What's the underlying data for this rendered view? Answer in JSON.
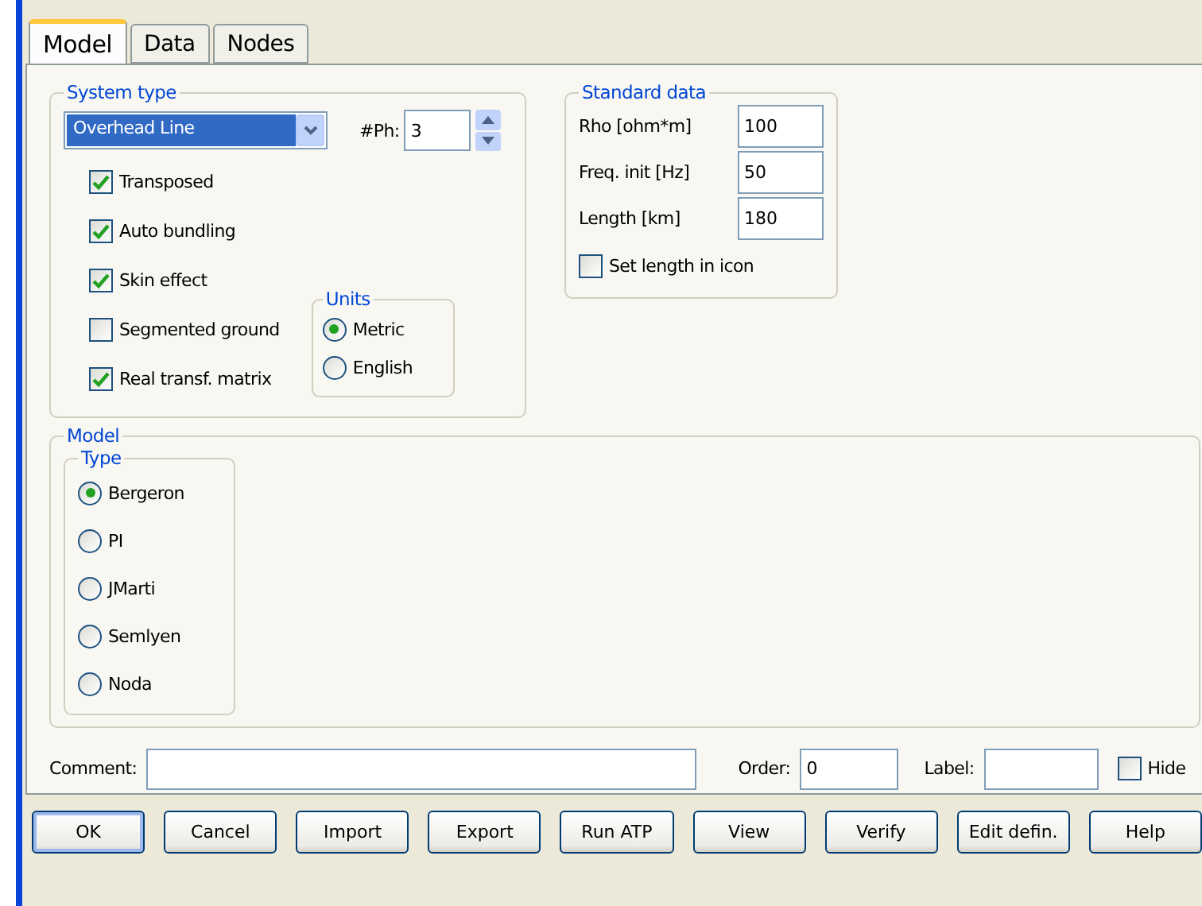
{
  "tabs": [
    {
      "label": "Model",
      "selected": true
    },
    {
      "label": "Data",
      "selected": false
    },
    {
      "label": "Nodes",
      "selected": false
    }
  ],
  "system_type": {
    "title": "System type",
    "dropdown": {
      "value": "Overhead Line"
    },
    "phases": {
      "label": "#Ph:",
      "value": "3"
    },
    "options": [
      {
        "label": "Transposed",
        "checked": true
      },
      {
        "label": "Auto bundling",
        "checked": true
      },
      {
        "label": "Skin effect",
        "checked": true
      },
      {
        "label": "Segmented ground",
        "checked": false
      },
      {
        "label": "Real transf. matrix",
        "checked": true
      }
    ],
    "units": {
      "title": "Units",
      "options": [
        {
          "label": "Metric",
          "selected": true
        },
        {
          "label": "English",
          "selected": false
        }
      ]
    }
  },
  "standard_data": {
    "title": "Standard data",
    "fields": [
      {
        "label": "Rho [ohm*m]",
        "value": "100"
      },
      {
        "label": "Freq. init [Hz]",
        "value": "50"
      },
      {
        "label": "Length [km]",
        "value": "180"
      }
    ],
    "set_length": {
      "label": "Set length in icon",
      "checked": false
    }
  },
  "model": {
    "title": "Model",
    "type": {
      "title": "Type",
      "options": [
        {
          "label": "Bergeron",
          "selected": true
        },
        {
          "label": "PI",
          "selected": false
        },
        {
          "label": "JMarti",
          "selected": false
        },
        {
          "label": "Semlyen",
          "selected": false
        },
        {
          "label": "Noda",
          "selected": false
        }
      ]
    }
  },
  "comment": {
    "label": "Comment:"
  },
  "order": {
    "label": "Order:",
    "value": "0"
  },
  "label_field": {
    "label": "Label:"
  },
  "hide": {
    "label": "Hide",
    "checked": false
  },
  "buttons": [
    {
      "label": "OK",
      "default": true
    },
    {
      "label": "Cancel",
      "default": false
    },
    {
      "label": "Import",
      "default": false
    },
    {
      "label": "Export",
      "default": false
    },
    {
      "label": "Run ATP",
      "default": false
    },
    {
      "label": "View",
      "default": false
    },
    {
      "label": "Verify",
      "default": false
    },
    {
      "label": "Edit defin.",
      "default": false
    },
    {
      "label": "Help",
      "default": false
    }
  ]
}
